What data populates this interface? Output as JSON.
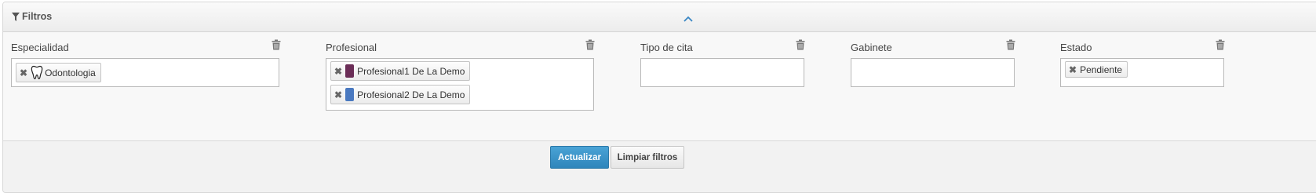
{
  "panel": {
    "title": "Filtros",
    "title_icon": "filter-icon",
    "toggle_icon": "chevron-up-icon"
  },
  "filters": {
    "especialidad": {
      "label": "Especialidad",
      "tags": [
        {
          "text": "Odontologia",
          "icon": "tooth-icon"
        }
      ]
    },
    "profesional": {
      "label": "Profesional",
      "tags": [
        {
          "text": "Profesional1 De La Demo",
          "color": "#6b2d57"
        },
        {
          "text": "Profesional2 De La Demo",
          "color": "#4a79c0"
        }
      ]
    },
    "tipo_cita": {
      "label": "Tipo de cita",
      "tags": []
    },
    "gabinete": {
      "label": "Gabinete",
      "tags": []
    },
    "estado": {
      "label": "Estado",
      "tags": [
        {
          "text": "Pendiente"
        }
      ]
    }
  },
  "actions": {
    "update_label": "Actualizar",
    "clear_label": "Limpiar filtros"
  },
  "colors": {
    "primary": "#3a93c9",
    "remove_mark": "#666666"
  }
}
